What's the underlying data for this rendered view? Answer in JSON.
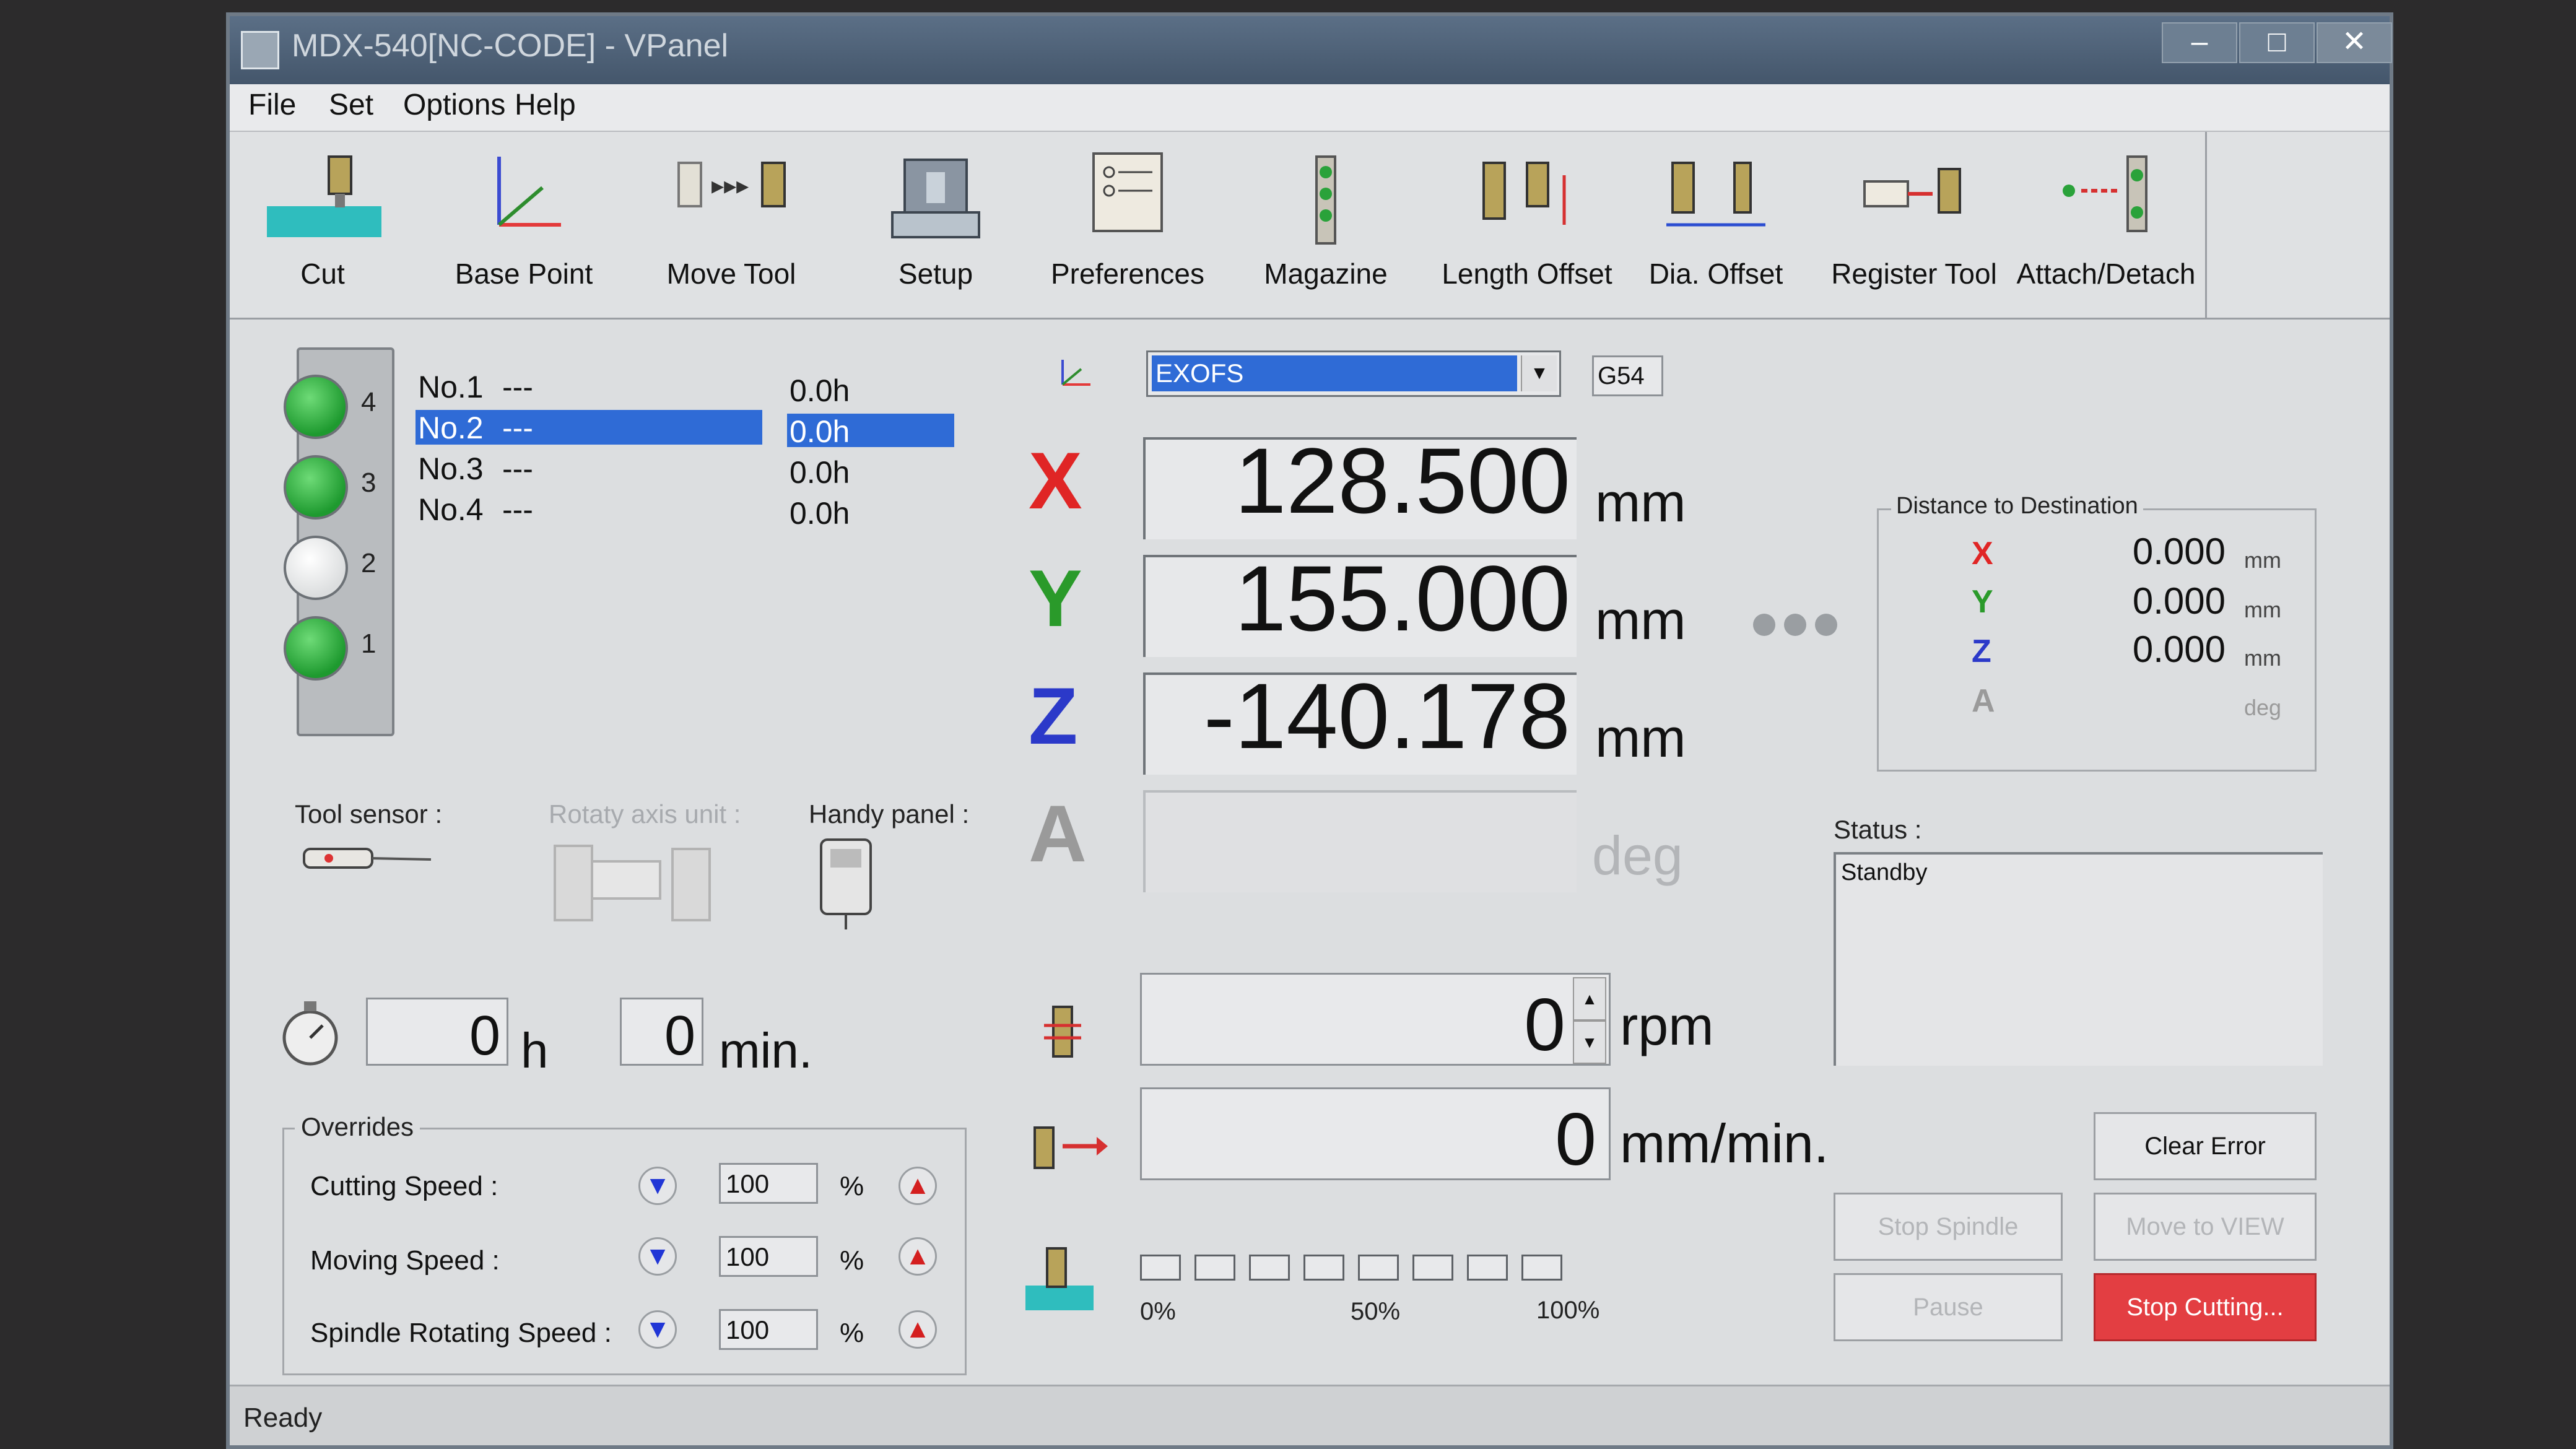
{
  "window": {
    "title": "MDX-540[NC-CODE] - VPanel"
  },
  "menu": [
    "File",
    "Set",
    "Options",
    "Help"
  ],
  "toolbar": [
    {
      "label": "Cut",
      "icon": "cut-icon"
    },
    {
      "label": "Base Point",
      "icon": "base-point-icon"
    },
    {
      "label": "Move Tool",
      "icon": "move-tool-icon"
    },
    {
      "label": "Setup",
      "icon": "setup-icon"
    },
    {
      "label": "Preferences",
      "icon": "preferences-icon"
    },
    {
      "label": "Magazine",
      "icon": "magazine-icon"
    },
    {
      "label": "Length Offset",
      "icon": "length-offset-icon"
    },
    {
      "label": "Dia. Offset",
      "icon": "dia-offset-icon"
    },
    {
      "label": "Register Tool",
      "icon": "register-tool-icon"
    },
    {
      "label": "Attach/Detach",
      "icon": "attach-detach-icon"
    }
  ],
  "magazine": {
    "slots": [
      {
        "num": "4",
        "state": "on"
      },
      {
        "num": "3",
        "state": "on"
      },
      {
        "num": "2",
        "state": "off"
      },
      {
        "num": "1",
        "state": "on"
      }
    ],
    "tools": [
      {
        "name": "No.1",
        "desc": "---",
        "time": "0.0h",
        "selected": false
      },
      {
        "name": "No.2",
        "desc": "---",
        "time": "0.0h",
        "selected": true
      },
      {
        "name": "No.3",
        "desc": "---",
        "time": "0.0h",
        "selected": false
      },
      {
        "name": "No.4",
        "desc": "---",
        "time": "0.0h",
        "selected": false
      }
    ]
  },
  "devices": {
    "tool_sensor": "Tool sensor :",
    "rotary_axis": "Rotaty axis unit :",
    "handy_panel": "Handy panel :"
  },
  "timer": {
    "hours": "0",
    "h_unit": "h",
    "minutes": "0",
    "min_unit": "min."
  },
  "overrides": {
    "title": "Overrides",
    "items": [
      {
        "label": "Cutting Speed :",
        "value": "100",
        "unit": "%"
      },
      {
        "label": "Moving Speed :",
        "value": "100",
        "unit": "%"
      },
      {
        "label": "Spindle Rotating Speed :",
        "value": "100",
        "unit": "%"
      }
    ]
  },
  "coords": {
    "system": "EXOFS",
    "code": "G54",
    "axes": [
      {
        "axis": "X",
        "value": "128.500",
        "unit": "mm",
        "color": "#e02525"
      },
      {
        "axis": "Y",
        "value": "155.000",
        "unit": "mm",
        "color": "#2a9a2a"
      },
      {
        "axis": "Z",
        "value": "-140.178",
        "unit": "mm",
        "color": "#2b39c9"
      },
      {
        "axis": "A",
        "value": "",
        "unit": "deg",
        "color": "#9a9a9a"
      }
    ]
  },
  "spindle": {
    "value": "0",
    "unit": "rpm"
  },
  "feed": {
    "value": "0",
    "unit": "mm/min."
  },
  "progress": {
    "percent": 0,
    "labels": [
      "0%",
      "50%",
      "100%"
    ],
    "boxes": 8
  },
  "destination": {
    "title": "Distance to Destination",
    "axes": [
      {
        "axis": "X",
        "value": "0.000",
        "unit": "mm",
        "color": "#e02525"
      },
      {
        "axis": "Y",
        "value": "0.000",
        "unit": "mm",
        "color": "#2a9a2a"
      },
      {
        "axis": "Z",
        "value": "0.000",
        "unit": "mm",
        "color": "#2b39c9"
      },
      {
        "axis": "A",
        "value": "",
        "unit": "deg",
        "color": "#9a9a9a"
      }
    ]
  },
  "status": {
    "label": "Status :",
    "text": "Standby"
  },
  "buttons": {
    "clear_error": "Clear Error",
    "stop_spindle": "Stop Spindle",
    "move_to_view": "Move to VIEW",
    "pause": "Pause",
    "stop_cutting": "Stop Cutting..."
  },
  "statusbar": "Ready"
}
